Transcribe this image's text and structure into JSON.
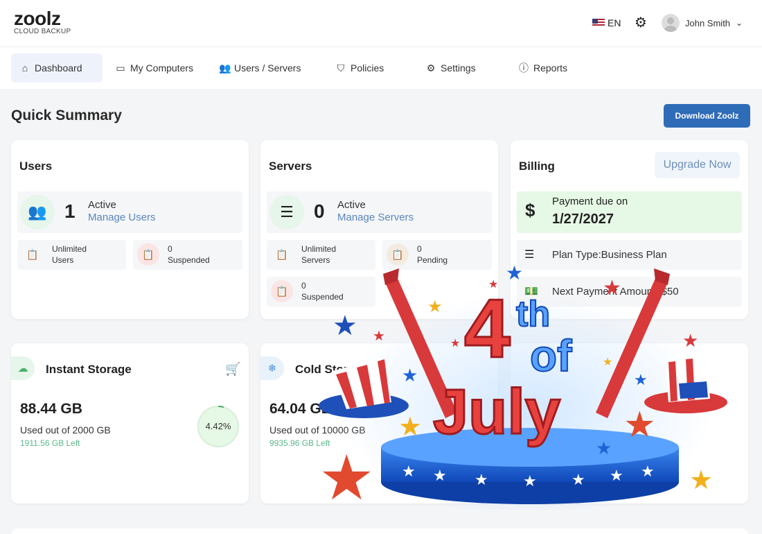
{
  "header": {
    "logo_main": "zoolz",
    "logo_sub": "CLOUD BACKUP",
    "language": "EN",
    "user_name": "John Smith"
  },
  "nav": {
    "items": [
      {
        "label": "Dashboard",
        "icon": "home-icon"
      },
      {
        "label": "My Computers",
        "icon": "laptop-icon"
      },
      {
        "label": "Users / Servers",
        "icon": "users-icon"
      },
      {
        "label": "Policies",
        "icon": "shield-icon"
      },
      {
        "label": "Settings",
        "icon": "gear-icon"
      },
      {
        "label": "Reports",
        "icon": "info-icon"
      }
    ]
  },
  "summary": {
    "title": "Quick Summary",
    "download_label": "Download Zoolz"
  },
  "users_card": {
    "title": "Users",
    "count": "1",
    "active_label": "Active",
    "manage_link": "Manage Users",
    "unlimited_line1": "Unlimited",
    "unlimited_line2": "Users",
    "suspended_count": "0",
    "suspended_label": "Suspended"
  },
  "servers_card": {
    "title": "Servers",
    "count": "0",
    "active_label": "Active",
    "manage_link": "Manage Servers",
    "unlimited_line1": "Unlimited",
    "unlimited_line2": "Servers",
    "pending_count": "0",
    "pending_label": "Pending",
    "suspended_count": "0",
    "suspended_label": "Suspended"
  },
  "billing_card": {
    "title": "Billing",
    "upgrade_label": "Upgrade Now",
    "payment_due_label": "Payment due on",
    "payment_due_date": "1/27/2027",
    "plan_type": "Plan Type:Business Plan",
    "next_payment": "Next Payment Amount: $50"
  },
  "instant_storage": {
    "title": "Instant Storage",
    "used": "88.44 GB",
    "used_out_of": "Used out of  2000 GB",
    "left": "1911.56 GB Left",
    "percent_label": "4.42%",
    "percent_value": 0.0442
  },
  "cold_storage": {
    "title": "Cold Storage",
    "used": "64.04 GB",
    "used_out_of": "Used out of  10000 GB",
    "left": "9935.96 GB Left"
  },
  "promo": {
    "line1": "4th",
    "line2": "of",
    "line3": "July"
  },
  "colors": {
    "accent": "#2f6cb8",
    "link": "#5a86bd",
    "success": "#5cb88a",
    "promo_red": "#e8423f",
    "promo_blue": "#1f63d6"
  }
}
